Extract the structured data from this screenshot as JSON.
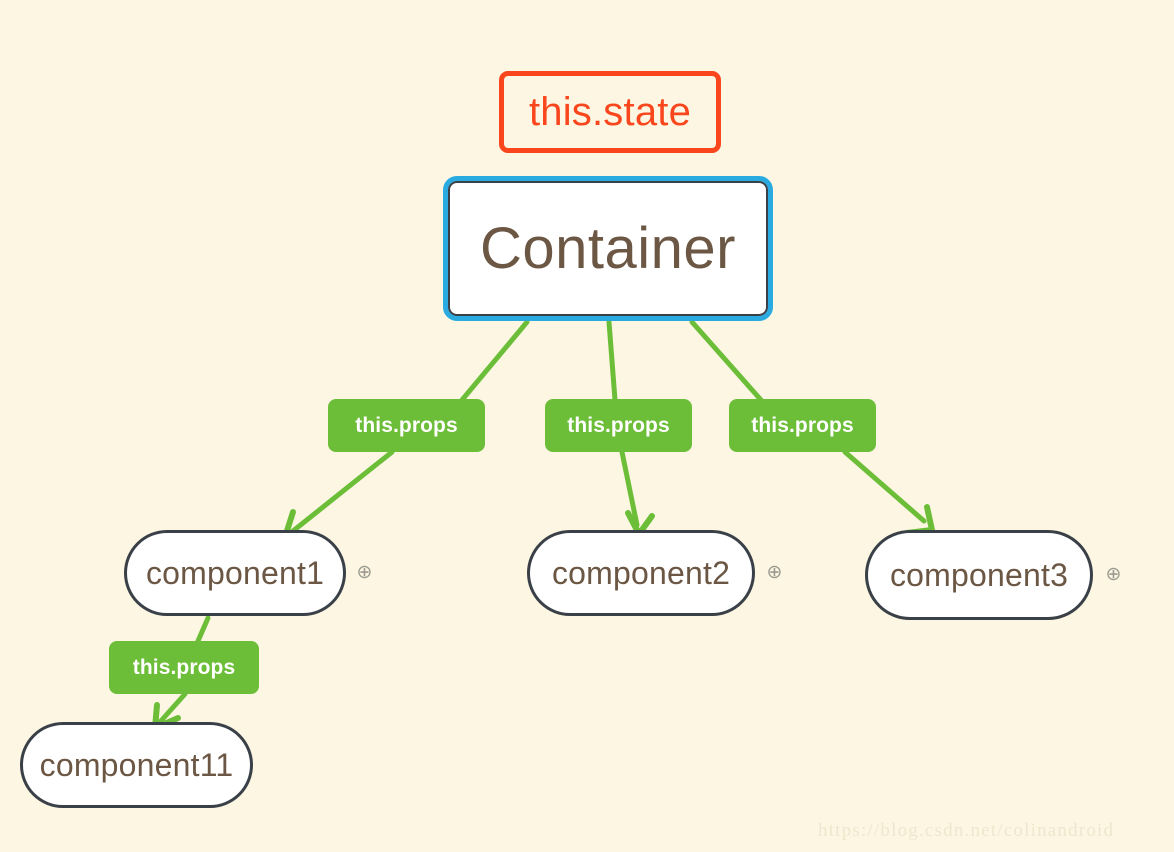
{
  "diagram": {
    "background_color": "#fcf6e3",
    "nodes": {
      "state": {
        "label": "this.state",
        "border_color": "#f9461c",
        "text_color": "#f9461c"
      },
      "container": {
        "label": "Container",
        "border_color": "#29abe2",
        "inner_border_color": "#3a4047",
        "fill_color": "#ffffff",
        "text_color": "#6b5744"
      },
      "component1": {
        "label": "component1",
        "border_color": "#3a4047",
        "text_color": "#6b5744",
        "expand_icon": "plus-circle-icon"
      },
      "component2": {
        "label": "component2",
        "border_color": "#3a4047",
        "text_color": "#6b5744",
        "expand_icon": "plus-circle-icon"
      },
      "component3": {
        "label": "component3",
        "border_color": "#3a4047",
        "text_color": "#6b5744",
        "expand_icon": "plus-circle-icon"
      },
      "component11": {
        "label": "component11",
        "border_color": "#3a4047",
        "text_color": "#6b5744"
      }
    },
    "edge_labels": {
      "props_1": "this.props",
      "props_2": "this.props",
      "props_3": "this.props",
      "props_4": "this.props",
      "chip_color": "#6cbe38",
      "chip_text_color": "#ffffff"
    },
    "edges": {
      "color": "#6cbe38",
      "list": [
        {
          "from": "container",
          "to": "component1",
          "label": "this.props"
        },
        {
          "from": "container",
          "to": "component2",
          "label": "this.props"
        },
        {
          "from": "container",
          "to": "component3",
          "label": "this.props"
        },
        {
          "from": "component1",
          "to": "component11",
          "label": "this.props"
        }
      ]
    },
    "expand_badges": {
      "component1": "⊕",
      "component2": "⊕",
      "component3": "⊕"
    },
    "watermark": "https://blog.csdn.net/colinandroid"
  }
}
